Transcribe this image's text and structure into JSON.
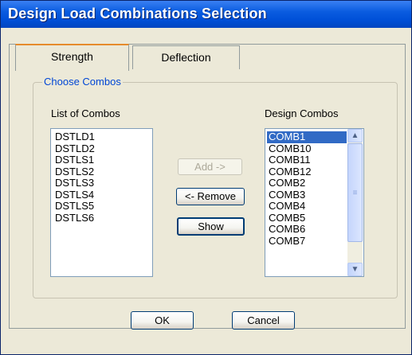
{
  "window": {
    "title": "Design Load Combinations Selection"
  },
  "tabs": [
    {
      "label": "Strength",
      "active": true
    },
    {
      "label": "Deflection",
      "active": false
    }
  ],
  "group": {
    "label": "Choose Combos"
  },
  "list_of_combos": {
    "label": "List of Combos",
    "items": [
      "DSTLD1",
      "DSTLD2",
      "DSTLS1",
      "DSTLS2",
      "DSTLS3",
      "DSTLS4",
      "DSTLS5",
      "DSTLS6"
    ]
  },
  "design_combos": {
    "label": "Design Combos",
    "items": [
      "COMB1",
      "COMB10",
      "COMB11",
      "COMB12",
      "COMB2",
      "COMB3",
      "COMB4",
      "COMB5",
      "COMB6",
      "COMB7"
    ],
    "selected": "COMB1"
  },
  "buttons": {
    "add": "Add ->",
    "remove": "<- Remove",
    "show": "Show",
    "ok": "OK",
    "cancel": "Cancel"
  },
  "scrollbar": {
    "up_glyph": "▲",
    "down_glyph": "▼",
    "grip_glyph": "≡"
  },
  "colors": {
    "title_bar": "#0050d8",
    "selection": "#316ac5",
    "group_label": "#0046d5",
    "active_tab_accent": "#e68b2c"
  }
}
